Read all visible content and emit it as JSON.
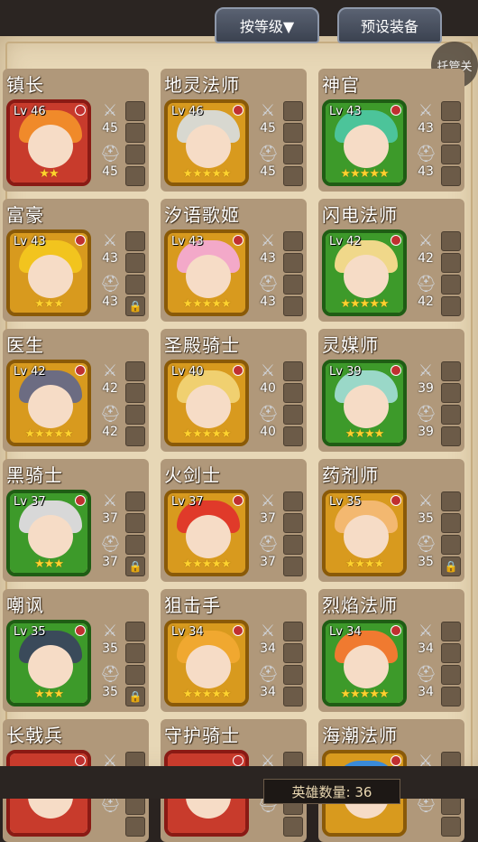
{
  "header": {
    "sort_label": "按等级▼",
    "preset_label": "预设装备",
    "auto_label": "托管关"
  },
  "footer": {
    "hero_count": "英雄数量: 36"
  },
  "colors": {
    "panel": "#e7d7b6",
    "card": "#b0987a",
    "red_rim": "#c83b2c",
    "gold_rim": "#d89a1e",
    "green_rim": "#3d9a2a"
  },
  "heroes": [
    {
      "name": "镇长",
      "level": "Lv 46",
      "weapon": "45",
      "armor": "45",
      "stars": "★★",
      "rim": "red",
      "locked": false,
      "hair": "#f08a2a"
    },
    {
      "name": "地灵法师",
      "level": "Lv 46",
      "weapon": "45",
      "armor": "45",
      "stars": "★★★★★",
      "rim": "gold",
      "locked": false,
      "hair": "#d8d8d0"
    },
    {
      "name": "神官",
      "level": "Lv 43",
      "weapon": "43",
      "armor": "43",
      "stars": "★★★★★",
      "rim": "green",
      "locked": false,
      "hair": "#4cc49a"
    },
    {
      "name": "富豪",
      "level": "Lv 43",
      "weapon": "43",
      "armor": "43",
      "stars": "★★★",
      "rim": "gold",
      "locked": true,
      "hair": "#f2c41e"
    },
    {
      "name": "汐语歌姬",
      "level": "Lv 43",
      "weapon": "43",
      "armor": "43",
      "stars": "★★★★★",
      "rim": "gold",
      "locked": false,
      "hair": "#f3a9c9"
    },
    {
      "name": "闪电法师",
      "level": "Lv 42",
      "weapon": "42",
      "armor": "42",
      "stars": "★★★★★",
      "rim": "green",
      "locked": false,
      "hair": "#f0d88a"
    },
    {
      "name": "医生",
      "level": "Lv 42",
      "weapon": "42",
      "armor": "42",
      "stars": "★★★★★",
      "rim": "gold",
      "locked": false,
      "hair": "#6c6c82"
    },
    {
      "name": "圣殿骑士",
      "level": "Lv 40",
      "weapon": "40",
      "armor": "40",
      "stars": "★★★★★",
      "rim": "gold",
      "locked": false,
      "hair": "#f0d070"
    },
    {
      "name": "灵媒师",
      "level": "Lv 39",
      "weapon": "39",
      "armor": "39",
      "stars": "★★★★",
      "rim": "green",
      "locked": false,
      "hair": "#9ad8c8"
    },
    {
      "name": "黑骑士",
      "level": "Lv 37",
      "weapon": "37",
      "armor": "37",
      "stars": "★★★",
      "rim": "green",
      "locked": true,
      "hair": "#d8d8d8"
    },
    {
      "name": "火剑士",
      "level": "Lv 37",
      "weapon": "37",
      "armor": "37",
      "stars": "★★★★★",
      "rim": "gold",
      "locked": false,
      "hair": "#e03a2a"
    },
    {
      "name": "药剂师",
      "level": "Lv 35",
      "weapon": "35",
      "armor": "35",
      "stars": "★★★★",
      "rim": "gold",
      "locked": true,
      "hair": "#f3b870"
    },
    {
      "name": "嘲讽",
      "level": "Lv 35",
      "weapon": "35",
      "armor": "35",
      "stars": "★★★",
      "rim": "green",
      "locked": true,
      "hair": "#3a4a5a"
    },
    {
      "name": "狙击手",
      "level": "Lv 34",
      "weapon": "34",
      "armor": "34",
      "stars": "★★★★★",
      "rim": "gold",
      "locked": false,
      "hair": "#f0a830"
    },
    {
      "name": "烈焰法师",
      "level": "Lv 34",
      "weapon": "34",
      "armor": "34",
      "stars": "★★★★★",
      "rim": "green",
      "locked": false,
      "hair": "#f07a30"
    },
    {
      "name": "长戟兵",
      "level": "",
      "weapon": "",
      "armor": "",
      "stars": "",
      "rim": "red",
      "locked": false,
      "hair": "#c83b2c"
    },
    {
      "name": "守护骑士",
      "level": "",
      "weapon": "",
      "armor": "",
      "stars": "",
      "rim": "red",
      "locked": false,
      "hair": "#c83b2c"
    },
    {
      "name": "海潮法师",
      "level": "",
      "weapon": "",
      "armor": "",
      "stars": "",
      "rim": "gold",
      "locked": false,
      "hair": "#3a8ad8"
    }
  ]
}
